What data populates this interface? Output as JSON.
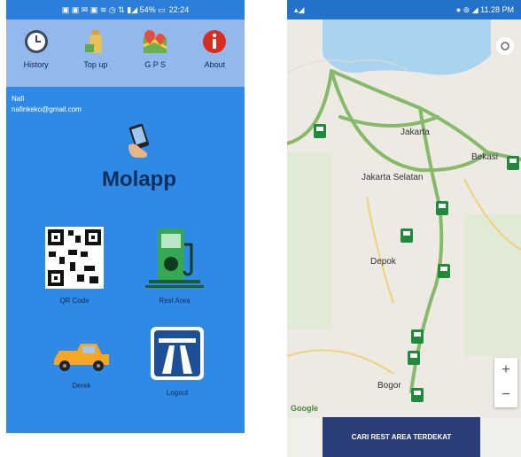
{
  "left": {
    "status_icons": "▣ ▣ ✉ ▣  ≋ ◷  ⇅ ▮◢ 54% ▭",
    "status_time": "22:24",
    "menu": [
      {
        "label": "History",
        "icon": "clock-icon"
      },
      {
        "label": "Top up",
        "icon": "bottle-icon"
      },
      {
        "label": "G P S",
        "icon": "map-pin-icon"
      },
      {
        "label": "About",
        "icon": "info-icon"
      }
    ],
    "user": {
      "name": "Nafi",
      "email": "nafinkeko@gmail.com"
    },
    "app_title": "Molapp",
    "tiles": [
      {
        "label": "QR Code",
        "icon": "qr-code-icon"
      },
      {
        "label": "Rest Area",
        "icon": "fuel-pump-icon"
      },
      {
        "label": "Derek",
        "icon": "tow-truck-icon"
      },
      {
        "label": "Logout",
        "icon": "highway-sign-icon"
      }
    ]
  },
  "right": {
    "status_left": "▴◢",
    "status_right": "● ⊚ ◢ 11.28 PM",
    "map_labels": [
      "Jakarta",
      "Jakarta Selatan",
      "Bekasi",
      "Depok",
      "Bogor",
      "Google"
    ],
    "zoom_in": "+",
    "zoom_out": "−",
    "button": "CARI REST AREA TERDEKAT"
  }
}
